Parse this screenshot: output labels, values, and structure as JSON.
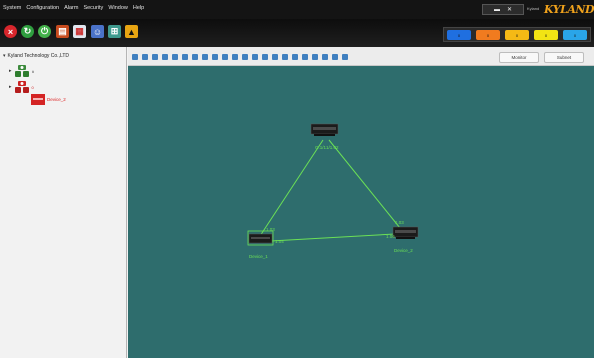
{
  "menu": {
    "items": [
      "System",
      "Configuration",
      "Alarm",
      "Security",
      "Window",
      "Help"
    ]
  },
  "titlebar": {
    "brand_text": "Kyland",
    "logo_text": "KYLAND"
  },
  "left_panel": {
    "root_label": "Kyland Technology Co.,LTD",
    "nodes": [
      {
        "label": "Device_2"
      }
    ]
  },
  "canvas_tabs": [
    "Monitor",
    "Subnet"
  ],
  "topology": {
    "devices": [
      {
        "label": ""
      },
      {
        "label": "Device_1"
      },
      {
        "label": "Device_2"
      }
    ],
    "port_labels": [
      "G.1/1",
      "1/1.02",
      "1.03",
      "1.04",
      "1.03",
      "1.06",
      "1.04"
    ]
  },
  "colors": {
    "canvas_bg": "#2e6d6d",
    "link": "#6be056",
    "alarm": [
      "#1f6fe0",
      "#f17b1f",
      "#f5b915",
      "#f2e414",
      "#2aa5e8"
    ]
  },
  "icons": {
    "toolbar": [
      "stop-icon",
      "refresh-icon",
      "power-icon",
      "device-list-icon",
      "report-icon",
      "user-icon",
      "network-icon",
      "warning-icon"
    ]
  }
}
